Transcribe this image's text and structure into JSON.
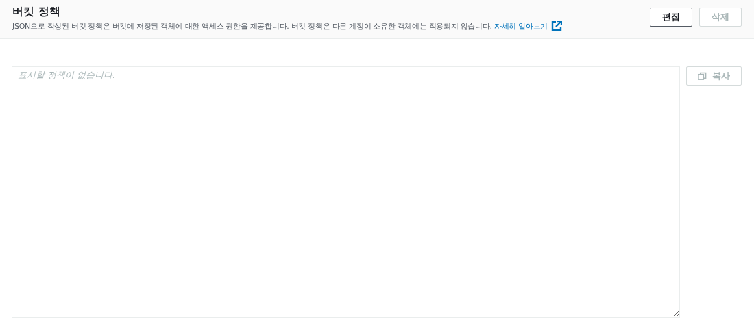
{
  "header": {
    "title": "버킷 정책",
    "description": "JSON으로 작성된 버킷 정책은 버킷에 저장된 객체에 대한 액세스 권한을 제공합니다. 버킷 정책은 다른 계정이 소유한 객체에는 적용되지 않습니다.",
    "link": "자세히 알아보기"
  },
  "buttons": [
    {
      "label": "편집",
      "disabled": false
    },
    {
      "label": "삭제",
      "disabled": true
    }
  ],
  "policy_editor": {
    "placeholder": "표시할 정책이 없습니다."
  },
  "copy_button": {
    "label": "복사",
    "disabled": true
  }
}
